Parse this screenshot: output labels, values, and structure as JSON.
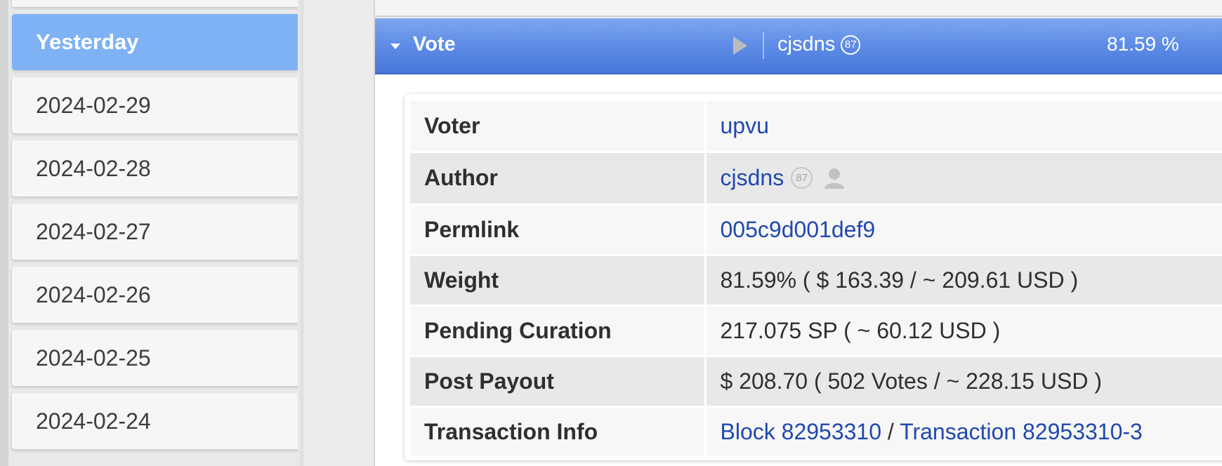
{
  "sidebar": {
    "dates": [
      {
        "label": "Yesterday",
        "active": true
      },
      {
        "label": "2024-02-29",
        "active": false
      },
      {
        "label": "2024-02-28",
        "active": false
      },
      {
        "label": "2024-02-27",
        "active": false
      },
      {
        "label": "2024-02-26",
        "active": false
      },
      {
        "label": "2024-02-25",
        "active": false
      },
      {
        "label": "2024-02-24",
        "active": false
      }
    ]
  },
  "vote_header": {
    "label": "Vote",
    "user": "cjsdns",
    "user_rep": "87",
    "percent": "81.59 %",
    "icons": [
      "caret-down-icon",
      "play-icon"
    ]
  },
  "details": {
    "voter": {
      "key": "Voter",
      "value": "upvu"
    },
    "author": {
      "key": "Author",
      "value": "cjsdns",
      "rep": "87",
      "icon": "user-icon"
    },
    "permlink": {
      "key": "Permlink",
      "value": "005c9d001def9"
    },
    "weight": {
      "key": "Weight",
      "value": "81.59% ( $ 163.39 / ~ 209.61 USD )"
    },
    "pending_curation": {
      "key": "Pending Curation",
      "value": "217.075 SP ( ~ 60.12 USD )"
    },
    "post_payout": {
      "key": "Post Payout",
      "value": "$ 208.70 ( 502 Votes / ~ 228.15 USD )"
    },
    "transaction_info": {
      "key": "Transaction Info",
      "block": "Block 82953310",
      "separator": " / ",
      "transaction": "Transaction 82953310-3"
    }
  },
  "colors": {
    "active_date_bg": "#7eb2f5",
    "vote_bar": "#5d8be6",
    "link": "#1f48b0"
  }
}
